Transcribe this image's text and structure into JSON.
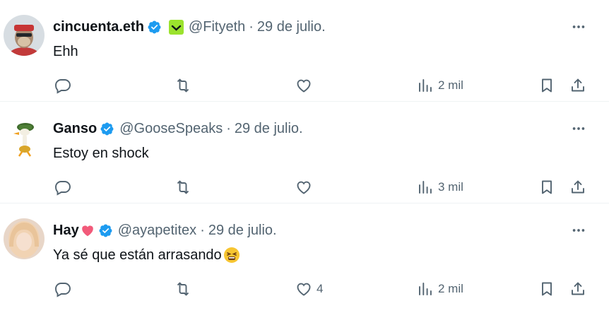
{
  "tweets": [
    {
      "name": "cincuenta.eth",
      "handle": "@Fityeth",
      "separator": "·",
      "date": "29 de julio.",
      "text": "Ehh",
      "views": "2 mil",
      "likes": "",
      "extra_badge": "lime-face-badge"
    },
    {
      "name": "Ganso",
      "handle": "@GooseSpeaks",
      "separator": "·",
      "date": "29 de julio.",
      "text": "Estoy en shock",
      "views": "3 mil",
      "likes": ""
    },
    {
      "name": "Hay",
      "handle": "@ayapetitex",
      "separator": "·",
      "date": "29 de julio.",
      "text": "Ya sé que están arrasando",
      "views": "2 mil",
      "likes": "4"
    }
  ],
  "colors": {
    "verified": "#1d9bf0",
    "secondary_text": "#536471",
    "primary_text": "#0f1419",
    "divider": "#eff3f4",
    "badge": "#9be22d"
  }
}
